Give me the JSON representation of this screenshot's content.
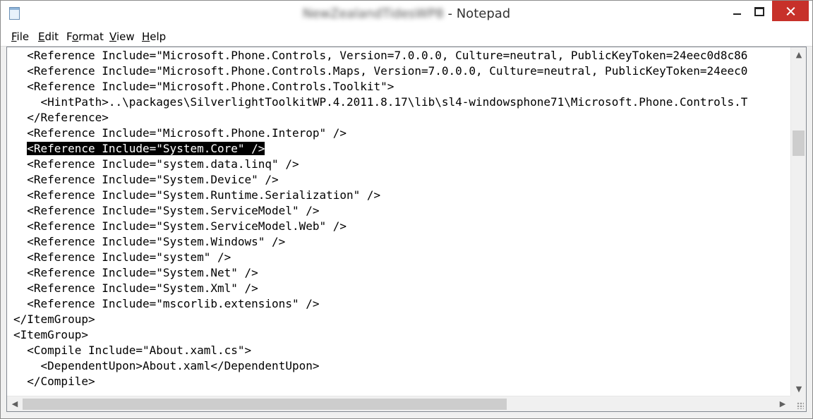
{
  "window": {
    "document_name": "NewZealandTidesWP8",
    "separator": " - ",
    "app_name": "Notepad"
  },
  "menu": {
    "file": {
      "accel": "F",
      "rest": "ile"
    },
    "edit": {
      "accel": "E",
      "rest": "dit"
    },
    "format_pre": "F",
    "format_accel": "o",
    "format_post": "rmat",
    "view": {
      "accel": "V",
      "rest": "iew"
    },
    "help": {
      "accel": "H",
      "rest": "elp"
    }
  },
  "lines": [
    "  <Reference Include=\"Microsoft.Phone.Controls, Version=7.0.0.0, Culture=neutral, PublicKeyToken=24eec0d8c86",
    "  <Reference Include=\"Microsoft.Phone.Controls.Maps, Version=7.0.0.0, Culture=neutral, PublicKeyToken=24eec0",
    "  <Reference Include=\"Microsoft.Phone.Controls.Toolkit\">",
    "    <HintPath>..\\packages\\SilverlightToolkitWP.4.2011.8.17\\lib\\sl4-windowsphone71\\Microsoft.Phone.Controls.T",
    "  </Reference>",
    "  <Reference Include=\"Microsoft.Phone.Interop\" />",
    "  <Reference Include=\"System.Core\" />",
    "  <Reference Include=\"system.data.linq\" />",
    "  <Reference Include=\"System.Device\" />",
    "  <Reference Include=\"System.Runtime.Serialization\" />",
    "  <Reference Include=\"System.ServiceModel\" />",
    "  <Reference Include=\"System.ServiceModel.Web\" />",
    "  <Reference Include=\"System.Windows\" />",
    "  <Reference Include=\"system\" />",
    "  <Reference Include=\"System.Net\" />",
    "  <Reference Include=\"System.Xml\" />",
    "  <Reference Include=\"mscorlib.extensions\" />",
    "</ItemGroup>",
    "<ItemGroup>",
    "  <Compile Include=\"About.xaml.cs\">",
    "    <DependentUpon>About.xaml</DependentUpon>",
    "  </Compile>"
  ],
  "selected_line": "<Reference Include=\"System.Core\" />",
  "icons": {
    "app": "notepad-icon",
    "minimize": "minimize-icon",
    "maximize": "maximize-icon",
    "close": "close-icon",
    "scroll_up": "▲",
    "scroll_down": "▼",
    "scroll_left": "◀",
    "scroll_right": "▶"
  },
  "colors": {
    "close_button": "#c7312a",
    "selection_bg": "#000000",
    "selection_fg": "#ffffff"
  }
}
